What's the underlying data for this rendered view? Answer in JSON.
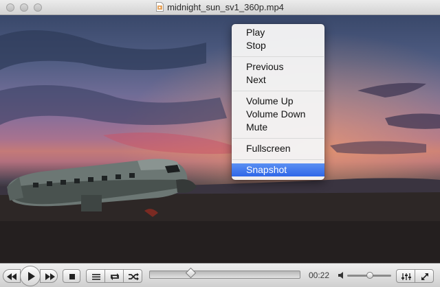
{
  "window": {
    "title": "midnight_sun_sv1_360p.mp4",
    "traffic_lights": [
      "close",
      "minimize",
      "zoom"
    ]
  },
  "context_menu": {
    "items": [
      {
        "label": "Play"
      },
      {
        "label": "Stop"
      },
      {
        "label": "Previous"
      },
      {
        "label": "Next"
      },
      {
        "label": "Volume Up"
      },
      {
        "label": "Volume Down"
      },
      {
        "label": "Mute"
      },
      {
        "label": "Fullscreen"
      },
      {
        "label": "Snapshot",
        "highlighted": true
      }
    ],
    "highlight_color": "#3a73ea"
  },
  "controls": {
    "buttons": [
      "rewind-icon",
      "play-icon",
      "fast-forward-icon",
      "stop-icon",
      "playlist-icon",
      "loop-icon",
      "shuffle-icon",
      "equalizer-icon",
      "fullscreen-icon"
    ],
    "time_elapsed": "00:22",
    "seek_position": 0.27,
    "volume_level": 0.52
  }
}
